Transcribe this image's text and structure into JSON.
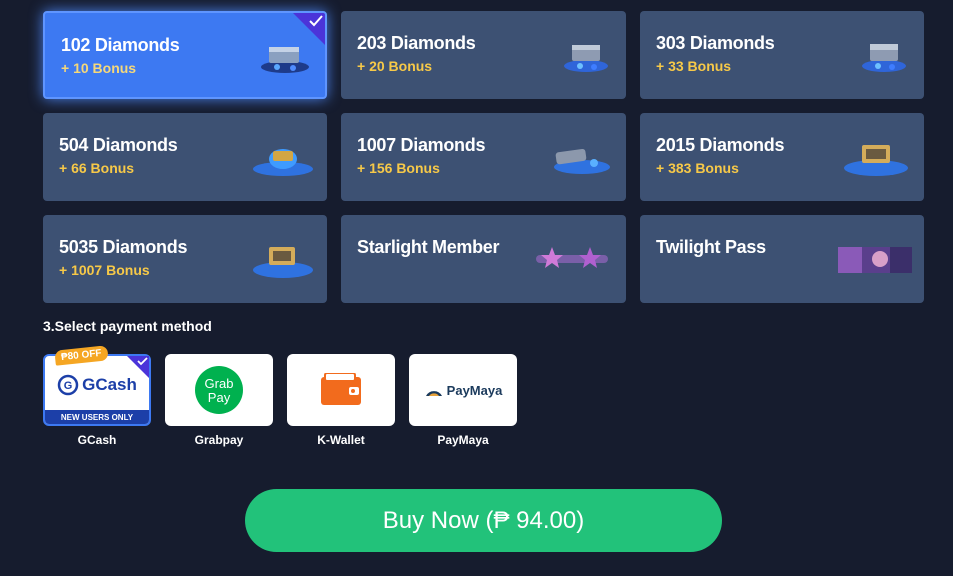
{
  "packages": [
    {
      "title": "102 Diamonds",
      "bonus": "+ 10 Bonus",
      "selected": true
    },
    {
      "title": "203 Diamonds",
      "bonus": "+ 20 Bonus",
      "selected": false
    },
    {
      "title": "303 Diamonds",
      "bonus": "+ 33 Bonus",
      "selected": false
    },
    {
      "title": "504 Diamonds",
      "bonus": "+ 66 Bonus",
      "selected": false
    },
    {
      "title": "1007 Diamonds",
      "bonus": "+ 156 Bonus",
      "selected": false
    },
    {
      "title": "2015 Diamonds",
      "bonus": "+ 383 Bonus",
      "selected": false
    },
    {
      "title": "5035 Diamonds",
      "bonus": "+ 1007 Bonus",
      "selected": false
    },
    {
      "title": "Starlight Member",
      "bonus": "",
      "selected": false
    },
    {
      "title": "Twilight Pass",
      "bonus": "",
      "selected": false
    }
  ],
  "payment": {
    "section_label": "3.Select payment method",
    "methods": [
      {
        "name": "GCash",
        "logo_text": "GCash",
        "promo": "₱80 OFF",
        "band": "NEW USERS ONLY",
        "selected": true
      },
      {
        "name": "Grabpay",
        "logo_text": "Grab Pay",
        "selected": false
      },
      {
        "name": "K-Wallet",
        "logo_text": "",
        "selected": false
      },
      {
        "name": "PayMaya",
        "logo_text": "PayMaya",
        "selected": false
      }
    ]
  },
  "buy_button": {
    "label": "Buy Now (₱ 94.00)"
  },
  "colors": {
    "background": "#161c2e",
    "card": "#3d5173",
    "card_selected": "#3d79f2",
    "bonus": "#f7c948",
    "check": "#4b34d9",
    "buy": "#22c27a"
  },
  "icons": {
    "package_art": [
      "diamond-chest-icon",
      "diamond-chest-icon",
      "diamond-chest-icon",
      "diamond-pile-icon",
      "diamond-pile-icon",
      "diamond-chest-icon",
      "diamond-chest-icon",
      "starlight-icon",
      "twilight-banner-icon"
    ],
    "check": "check-icon"
  }
}
